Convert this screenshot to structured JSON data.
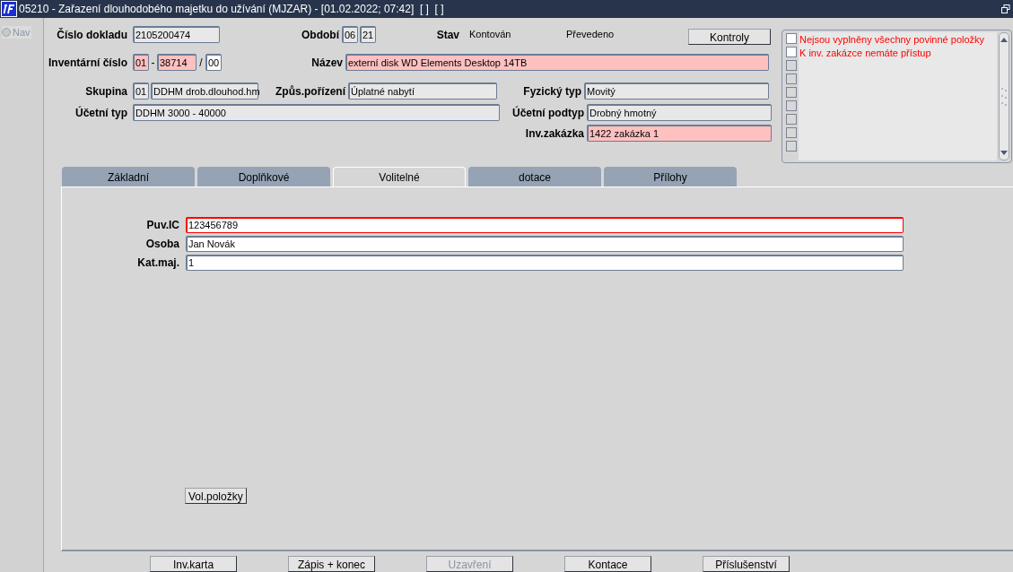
{
  "window": {
    "title": "05210 - Zařazení dlouhodobého majetku do užívání (MJZAR) - [01.02.2022; 07:42]  [ ]  [ ]"
  },
  "nav": {
    "label": "Nav",
    "selected": false
  },
  "header": {
    "cislo_dokladu": {
      "label": "Číslo dokladu",
      "value": "2105200474",
      "kind": "readonly"
    },
    "obdobi": {
      "label": "Období",
      "month": "06",
      "year": "21",
      "kind": "readonly"
    },
    "stav": {
      "label": "Stav",
      "value": "Kontován",
      "transfer": "Převedeno"
    },
    "kontroly_button": {
      "label": "Kontroly",
      "disabled": false
    },
    "inventarni_cislo": {
      "label": "Inventární číslo",
      "part_1": {
        "value": "01",
        "kind": "required"
      },
      "separator_1": "-",
      "part_2": {
        "value": "38714",
        "kind": "required"
      },
      "separator_2": "/",
      "part_3": {
        "value": "00",
        "kind": "editable"
      }
    },
    "nazev": {
      "label": "Název",
      "value": "externí disk WD Elements Desktop 14TB",
      "kind": "required"
    },
    "skupina": {
      "label": "Skupina",
      "code": "01",
      "value": "DDHM drob.dlouhod.hm",
      "kind": "readonly"
    },
    "zpus_porizeni": {
      "label": "Způs.pořízení",
      "value": "Úplatné nabytí",
      "kind": "readonly"
    },
    "fyzicky_typ": {
      "label": "Fyzický typ",
      "value": "Movitý",
      "kind": "readonly"
    },
    "ucetni_typ": {
      "label": "Účetní typ",
      "value": "DDHM 3000 - 40000",
      "kind": "readonly"
    },
    "ucetni_podtyp": {
      "label": "Účetní podtyp",
      "value": "Drobný hmotný",
      "kind": "readonly"
    },
    "inv_zakazka": {
      "label": "Inv.zakázka",
      "value": "1422 zakázka 1",
      "kind": "required"
    }
  },
  "messages": [
    {
      "text": "Nejsou vyplněny všechny povinné položky",
      "checked": false,
      "disabled": false
    },
    {
      "text": "K inv. zakázce nemáte přístup",
      "checked": false,
      "disabled": false
    },
    {
      "checked": false,
      "disabled": true
    },
    {
      "checked": false,
      "disabled": true
    },
    {
      "checked": false,
      "disabled": true
    },
    {
      "checked": false,
      "disabled": true
    },
    {
      "checked": false,
      "disabled": true
    },
    {
      "checked": false,
      "disabled": true
    },
    {
      "checked": false,
      "disabled": true
    }
  ],
  "tabs": [
    {
      "label": "Základní",
      "selected": false
    },
    {
      "label": "Doplňkové",
      "selected": false
    },
    {
      "label": "Volitelné",
      "selected": true
    },
    {
      "label": "dotace",
      "selected": false
    },
    {
      "label": "Přílohy",
      "selected": false
    }
  ],
  "tab_fields": [
    {
      "label": "Puv.IC",
      "value": "123456789",
      "kind": "error"
    },
    {
      "label": "Osoba",
      "value": "Jan Novák",
      "kind": "editable"
    },
    {
      "label": "Kat.maj.",
      "value": "1",
      "kind": "editable"
    }
  ],
  "vol_polozky_button": {
    "label": "Vol.položky",
    "disabled": false
  },
  "bottom_buttons": [
    {
      "label": "Inv.karta",
      "disabled": false
    },
    {
      "label": "Zápis + konec",
      "disabled": false
    },
    {
      "label": "Uzavření",
      "disabled": true
    },
    {
      "label": "Kontace",
      "disabled": false
    },
    {
      "label": "Příslušenství",
      "disabled": false
    }
  ]
}
